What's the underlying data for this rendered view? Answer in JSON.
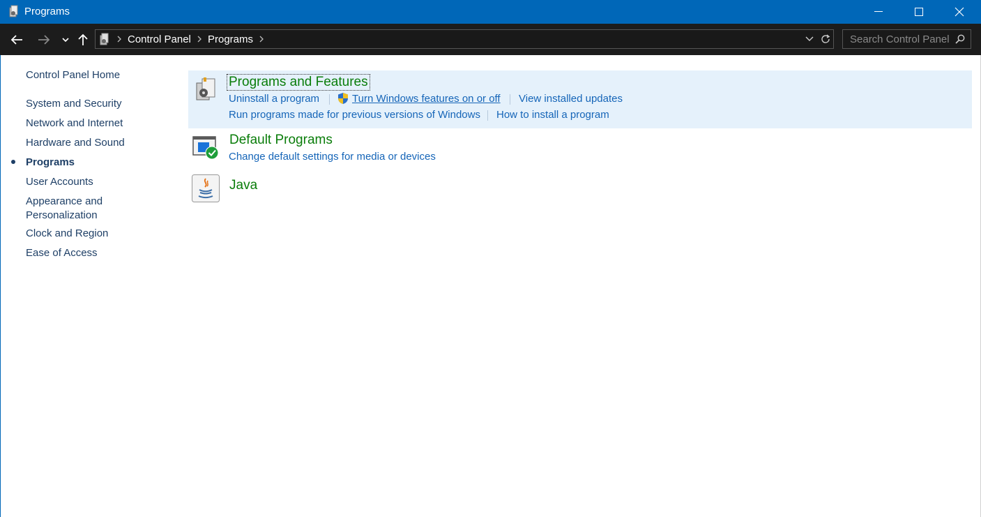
{
  "window": {
    "title": "Programs",
    "minimize": "minimize",
    "maximize": "maximize",
    "close": "close"
  },
  "address": {
    "crumbs": [
      "Control Panel",
      "Programs"
    ],
    "search_placeholder": "Search Control Panel"
  },
  "sidebar": {
    "home": "Control Panel Home",
    "items": [
      {
        "label": "System and Security"
      },
      {
        "label": "Network and Internet"
      },
      {
        "label": "Hardware and Sound"
      },
      {
        "label": "Programs",
        "current": true
      },
      {
        "label": "User Accounts"
      },
      {
        "label": "Appearance and",
        "label2": "Personalization"
      },
      {
        "label": "Clock and Region"
      },
      {
        "label": "Ease of Access"
      }
    ]
  },
  "main": {
    "programs_features": {
      "title": "Programs and Features",
      "links": [
        "Uninstall a program",
        "Turn Windows features on or off",
        "View installed updates",
        "Run programs made for previous versions of Windows",
        "How to install a program"
      ]
    },
    "default_programs": {
      "title": "Default Programs",
      "links": [
        "Change default settings for media or devices"
      ]
    },
    "java": {
      "title": "Java"
    }
  },
  "colors": {
    "titlebar": "#0067b8",
    "category_title": "#0a7d0a",
    "link": "#1565b8",
    "highlight": "#e5f1fb"
  }
}
